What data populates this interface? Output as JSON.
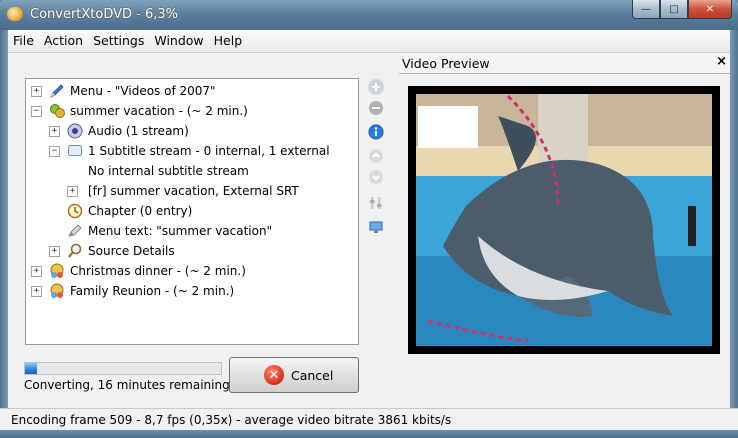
{
  "window": {
    "title": "ConvertXtoDVD - 6,3%",
    "minimize_glyph": "—",
    "maximize_glyph": "□",
    "close_glyph": "✕"
  },
  "menu": [
    "File",
    "Action",
    "Settings",
    "Window",
    "Help"
  ],
  "tree": {
    "items": [
      {
        "label": "Menu - \"Videos of 2007\"",
        "icon": "pen-icon",
        "expander": "+"
      },
      {
        "label": "summer vacation - (~ 2 min.)",
        "icon": "film-icon",
        "expander": "−"
      },
      {
        "label": "Audio (1 stream)",
        "icon": "speaker-icon",
        "expander": "+"
      },
      {
        "label": "1 Subtitle stream - 0 internal, 1 external",
        "icon": "subtitle-icon",
        "expander": "−"
      },
      {
        "label": "No internal subtitle stream",
        "icon": "",
        "expander": ""
      },
      {
        "label": "[fr] summer vacation, External SRT",
        "icon": "",
        "expander": "+"
      },
      {
        "label": "Chapter (0 entry)",
        "icon": "clock-icon",
        "expander": ""
      },
      {
        "label": "Menu text: \"summer vacation\"",
        "icon": "pen-icon",
        "expander": ""
      },
      {
        "label": "Source Details",
        "icon": "magnifier-icon",
        "expander": "+"
      },
      {
        "label": "Christmas dinner - (~ 2 min.)",
        "icon": "film-icon",
        "expander": "+"
      },
      {
        "label": "Family Reunion - (~ 2 min.)",
        "icon": "film-icon",
        "expander": "+"
      }
    ]
  },
  "side_buttons": [
    "add-icon",
    "remove-icon",
    "info-icon",
    "move-up-icon",
    "move-down-icon",
    "settings-icon",
    "preview-icon"
  ],
  "preview": {
    "title": "Video Preview",
    "close_glyph": "×"
  },
  "progress": {
    "percent": 0.063,
    "status": "Converting, 16 minutes remaining"
  },
  "cancel": {
    "label": "Cancel",
    "icon_glyph": "✕"
  },
  "statusbar": {
    "text": "Encoding frame 509 - 8,7 fps (0,35x) - average video bitrate 3861 kbits/s"
  },
  "colors": {
    "accent_progress": "#2f7fd6",
    "title_bar": "#5c7f9d",
    "cancel_icon": "#d92a12"
  }
}
